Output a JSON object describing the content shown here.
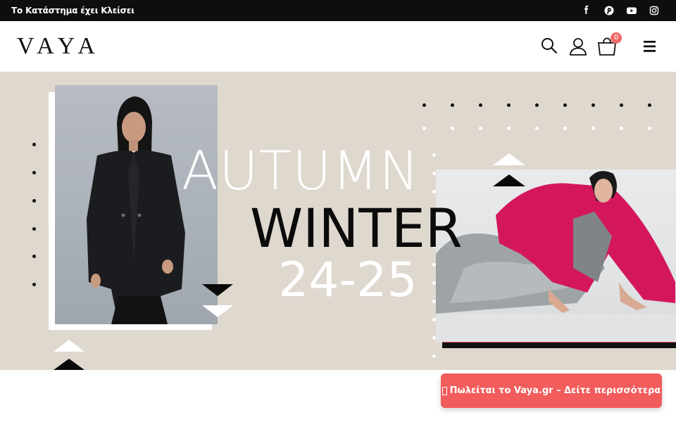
{
  "topbar": {
    "notice": "Το Κατάστημα έχει Κλείσει",
    "social": [
      "facebook-icon",
      "pinterest-icon",
      "youtube-icon",
      "instagram-icon"
    ]
  },
  "header": {
    "logo": "VAYA",
    "cart_count": "0",
    "icons": [
      "search-icon",
      "user-icon",
      "cart-icon",
      "menu-icon"
    ]
  },
  "hero": {
    "line1": "AUTUMN",
    "line2": "WINTER",
    "line3": "24-25"
  },
  "sale_button": {
    "label": "Πωλείται το Vaya.gr – Δείτε περισσότερα"
  },
  "colors": {
    "topbar": "#0e0e0e",
    "hero_bg": "#dfd8ce",
    "accent": "#f25c5c",
    "badge": "#ef6a6a"
  }
}
